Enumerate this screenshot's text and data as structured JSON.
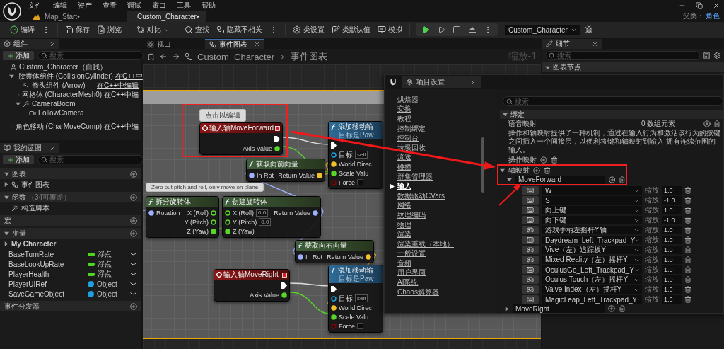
{
  "menu": [
    "文件",
    "编辑",
    "资产",
    "查看",
    "调试",
    "窗口",
    "工具",
    "帮助"
  ],
  "doc_tabs": [
    {
      "label": "Map_Start•",
      "kind": "level",
      "selected": false
    },
    {
      "label": "Custom_Character•",
      "kind": "blueprint",
      "selected": true
    }
  ],
  "parent_class": {
    "label": "父类：",
    "value": "角色"
  },
  "toolbar_groups": [
    {
      "items": [
        {
          "kind": "compile",
          "label": "编译"
        },
        {
          "kind": "more"
        }
      ]
    },
    {
      "items": [
        {
          "kind": "save",
          "label": "保存"
        },
        {
          "kind": "browse",
          "label": "浏览"
        }
      ]
    },
    {
      "items": [
        {
          "kind": "diff",
          "label": "对比",
          "dropdown": true
        }
      ]
    },
    {
      "items": [
        {
          "kind": "find",
          "label": "查找"
        },
        {
          "kind": "hide",
          "label": "隐藏不相关"
        },
        {
          "kind": "more"
        }
      ]
    },
    {
      "items": [
        {
          "kind": "class_settings",
          "label": "类设置"
        },
        {
          "kind": "class_defaults",
          "label": "类默认值"
        },
        {
          "kind": "simulate",
          "label": "模拟"
        }
      ]
    }
  ],
  "play_controls": [
    {
      "kind": "play"
    },
    {
      "kind": "step"
    },
    {
      "kind": "stop"
    },
    {
      "kind": "eject"
    },
    {
      "kind": "more"
    }
  ],
  "debug_target": "Custom_Character",
  "components": {
    "tab": "组件",
    "add": "添加",
    "search_placeholder": "搜索",
    "tree": [
      {
        "kind": "root",
        "name": "Custom_Character（自我）",
        "children": [
          {
            "kind": "capsule",
            "name": "胶囊体组件 (CollisionCylinder)",
            "link": "在C++中",
            "expanded": true,
            "children": [
              {
                "kind": "arrow",
                "name": "箭头组件 (Arrow)",
                "link": "在C++中编辑"
              },
              {
                "kind": "mesh",
                "name": "网格体 (CharacterMesh0)",
                "link": "在C++中编"
              },
              {
                "kind": "boom",
                "name": "CameraBoom",
                "expanded": true,
                "children": [
                  {
                    "kind": "camera",
                    "name": "FollowCamera"
                  }
                ]
              }
            ]
          },
          {
            "kind": "movement",
            "name": "角色移动 (CharMoveComp)",
            "link": "在C++中编"
          }
        ]
      }
    ]
  },
  "my_blueprint": {
    "tab": "我的蓝图",
    "add": "添加",
    "search_placeholder": "搜索",
    "sections": [
      {
        "label": "图表",
        "expanded": true,
        "items": [
          {
            "kind": "graph",
            "label": "事件图表",
            "expanded": false
          }
        ]
      },
      {
        "label": "函数",
        "note": "（34可覆盖）",
        "expanded": true,
        "items": [
          {
            "kind": "function",
            "label": "构造脚本"
          }
        ]
      },
      {
        "label": "宏"
      },
      {
        "label": "变量",
        "expanded": true,
        "items": [
          {
            "kind": "category",
            "label": "My Character",
            "expanded": false
          },
          {
            "kind": "variable",
            "label": "BaseTurnRate",
            "type": {
              "kind": "float",
              "label": "浮点"
            },
            "color": "#4cd61f"
          },
          {
            "kind": "variable",
            "label": "BaseLookUpRate",
            "type": {
              "kind": "float",
              "label": "浮点"
            },
            "color": "#4cd61f"
          },
          {
            "kind": "variable",
            "label": "PlayerHealth",
            "type": {
              "kind": "float",
              "label": "浮点"
            },
            "color": "#4cd61f"
          },
          {
            "kind": "variable",
            "label": "PlayerUIRef",
            "type": {
              "kind": "object",
              "label": "Object"
            },
            "color": "#1f9fe0"
          },
          {
            "kind": "variable",
            "label": "SaveGameObject",
            "type": {
              "kind": "object",
              "label": "Object"
            },
            "color": "#1f9fe0"
          }
        ]
      },
      {
        "label": "事件分发器"
      }
    ]
  },
  "graph": {
    "tabs": [
      {
        "label": "视口",
        "kind": "viewport",
        "selected": false
      },
      {
        "label": "事件图表",
        "kind": "graph",
        "selected": true
      }
    ],
    "breadcrumb": [
      "Custom_Character",
      "事件图表"
    ],
    "zoom": "缩放-1",
    "nodes": [
      {
        "kind": "event",
        "title": "输入轴MoveForward",
        "comment": "点击以编辑",
        "outputs": [
          {
            "kind": "exec"
          },
          {
            "kind": "float",
            "label": "Axis Value",
            "connected": true
          }
        ]
      },
      {
        "kind": "function",
        "title": "添加移动输",
        "subtitle": "目标是Paw",
        "inputs": [
          {
            "kind": "exec"
          },
          {
            "kind": "object",
            "label": "目标",
            "default": "self"
          },
          {
            "kind": "vector",
            "label": "World Direc",
            "connected": true
          },
          {
            "kind": "float",
            "label": "Scale Valu",
            "connected": true
          },
          {
            "kind": "bool",
            "label": "Force",
            "checked": false
          }
        ]
      },
      {
        "kind": "pure",
        "title": "获取向前向量",
        "inputs": [
          {
            "kind": "rotator",
            "label": "In Rot",
            "connected": true
          }
        ],
        "outputs": [
          {
            "kind": "vector",
            "label": "Return Value",
            "connected": true
          }
        ]
      },
      {
        "kind": "pure",
        "title": "拆分旋转体",
        "comment": "Zero out pitch and roll, only move on plane",
        "inputs": [
          {
            "kind": "rotator",
            "label": "Rotation",
            "connected": true
          }
        ],
        "outputs": [
          {
            "kind": "float",
            "label": "X (Roll)",
            "connected": false
          },
          {
            "kind": "float",
            "label": "Y (Pitch)",
            "connected": false
          },
          {
            "kind": "float",
            "label": "Z (Yaw)",
            "connected": true
          }
        ]
      },
      {
        "kind": "pure",
        "title": "创建旋转体",
        "inputs": [
          {
            "kind": "float",
            "label": "X (Roll)",
            "default": "0.0",
            "connected": false
          },
          {
            "kind": "float",
            "label": "Y (Pitch)",
            "default": "0.0",
            "connected": false
          },
          {
            "kind": "float",
            "label": "Z (Yaw)",
            "connected": true
          }
        ],
        "outputs": [
          {
            "kind": "rotator",
            "label": "Return Value",
            "connected": true
          }
        ]
      },
      {
        "kind": "pure",
        "title": "获取向右向量",
        "inputs": [
          {
            "kind": "rotator",
            "label": "In Rot",
            "connected": true
          }
        ],
        "outputs": [
          {
            "kind": "vector",
            "label": "Return Value",
            "connected": true
          }
        ]
      },
      {
        "kind": "event",
        "title": "输入轴MoveRight",
        "outputs": [
          {
            "kind": "exec"
          },
          {
            "kind": "float",
            "label": "Axis Value",
            "connected": true
          }
        ]
      },
      {
        "kind": "function",
        "title": "添加移动输",
        "subtitle": "目标是Paw",
        "inputs": [
          {
            "kind": "exec"
          },
          {
            "kind": "object",
            "label": "目标",
            "default": "self"
          },
          {
            "kind": "vector",
            "label": "World Direc",
            "connected": true
          },
          {
            "kind": "float",
            "label": "Scale Valu",
            "connected": true
          },
          {
            "kind": "bool",
            "label": "Force",
            "checked": false
          }
        ]
      }
    ]
  },
  "details": {
    "tab": "细节",
    "search_placeholder": "搜索",
    "section": "图表节点"
  },
  "project_settings": {
    "title": "项目设置",
    "categories": [
      {
        "label": "烘焙器",
        "selected": false
      },
      {
        "label": "交换",
        "selected": false
      },
      {
        "label": "教程",
        "selected": false
      },
      {
        "label": "控制绑定",
        "selected": false
      },
      {
        "label": "控制台",
        "selected": false
      },
      {
        "label": "垃圾回收",
        "selected": false
      },
      {
        "label": "流送",
        "selected": false
      },
      {
        "label": "碰撞",
        "selected": false
      },
      {
        "label": "群集管理器",
        "selected": false
      },
      {
        "label": "输入",
        "selected": true
      },
      {
        "label": "数据驱动CVars",
        "selected": false
      },
      {
        "label": "网络",
        "selected": false
      },
      {
        "label": "纹理编码",
        "selected": false
      },
      {
        "label": "物理",
        "selected": false
      },
      {
        "label": "渲染",
        "selected": false
      },
      {
        "label": "渲染重载（本地）",
        "selected": false
      },
      {
        "label": "一般设置",
        "selected": false
      },
      {
        "label": "音频",
        "selected": false
      },
      {
        "label": "用户界面",
        "selected": false
      },
      {
        "label": "AI系统",
        "selected": false
      },
      {
        "label": "Chaos解算器",
        "selected": false
      }
    ],
    "search_placeholder": "搜索",
    "section": {
      "label": "绑定",
      "expanded": true
    },
    "speech_mappings": {
      "label": "语音映射",
      "value": "0 数组元素"
    },
    "description": "操作和轴映射提供了一种机制，通过在输入行为和激活该行为的按键之间插入一个间接层，以便利将键和轴映射到输入 拥有连续范围的输入。",
    "action_mappings": "操作映射",
    "axis_mappings": {
      "label": "轴映射",
      "expanded": true
    },
    "axes": [
      {
        "name": "MoveForward",
        "expanded": true,
        "keys": [
          {
            "kind": "keyboard",
            "key": "W",
            "scale_label": "缩放",
            "scale": "1.0"
          },
          {
            "kind": "keyboard",
            "key": "S",
            "scale_label": "缩放",
            "scale": "-1.0"
          },
          {
            "kind": "keyboard",
            "key": "向上键",
            "scale_label": "缩放",
            "scale": "1.0"
          },
          {
            "kind": "keyboard",
            "key": "向下键",
            "scale_label": "缩放",
            "scale": "-1.0"
          },
          {
            "kind": "gamepad",
            "key": "游戏手柄左摇杆Y轴",
            "scale_label": "缩放",
            "scale": "1.0"
          },
          {
            "kind": "keyboard",
            "key": "Daydream_Left_Trackpad_Y",
            "scale_label": "缩放",
            "scale": "1.0"
          },
          {
            "kind": "gamepad",
            "key": "Vive（左）追踪板Y",
            "scale_label": "缩放",
            "scale": "1.0"
          },
          {
            "kind": "gamepad",
            "key": "Mixed Reality（左）摇杆Y",
            "scale_label": "缩放",
            "scale": "1.0"
          },
          {
            "kind": "keyboard",
            "key": "OculusGo_Left_Trackpad_Y",
            "scale_label": "缩放",
            "scale": "1.0"
          },
          {
            "kind": "gamepad",
            "key": "Oculus Touch（左）摇杆Y",
            "scale_label": "缩放",
            "scale": "1.0"
          },
          {
            "kind": "gamepad",
            "key": "Valve Index（左）摇杆Y",
            "scale_label": "缩放",
            "scale": "1.0"
          },
          {
            "kind": "keyboard",
            "key": "MagicLeap_Left_Trackpad_Y",
            "scale_label": "缩放",
            "scale": "1.0"
          }
        ]
      },
      {
        "name": "MoveRight",
        "expanded": false
      }
    ]
  }
}
